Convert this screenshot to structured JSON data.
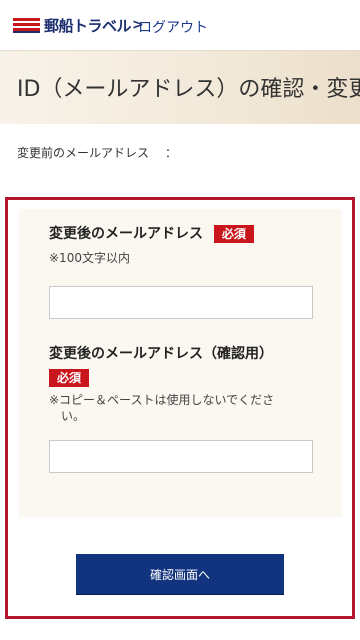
{
  "header": {
    "logo_text": "郵船トラベル",
    "logo_chevron": ">",
    "logout_label": "ログアウト"
  },
  "page": {
    "title": "ID（メールアドレス）の確認・変更"
  },
  "current_email": {
    "label": "変更前のメールアドレス",
    "colon": "：",
    "value": ""
  },
  "form": {
    "new_email": {
      "label": "変更後のメールアドレス",
      "required_badge": "必須",
      "note": "※100文字以内",
      "value": ""
    },
    "confirm_email": {
      "label": "変更後のメールアドレス（確認用）",
      "required_badge": "必須",
      "note_line1": "※コピー＆ペーストは使用しないでくださ",
      "note_line2": "い。",
      "value": ""
    },
    "submit_label": "確認画面へ"
  },
  "colors": {
    "brand_navy": "#12347f",
    "required_red": "#c9161d",
    "frame_red": "#b3182a"
  }
}
